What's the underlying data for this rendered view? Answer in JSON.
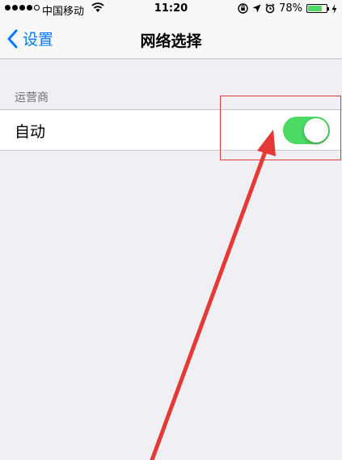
{
  "status_bar": {
    "signal_strength": "4/5",
    "carrier": "中国移动",
    "time": "11:20",
    "battery_percent": "78%",
    "battery_level": 0.78,
    "icons": [
      "signal-icon",
      "wifi-icon",
      "orientation-lock-icon",
      "location-icon",
      "alarm-icon",
      "battery-icon",
      "charging-icon"
    ]
  },
  "nav": {
    "back_label": "设置",
    "title": "网络选择"
  },
  "section": {
    "header": "运营商",
    "row_label": "自动",
    "toggle_on": true
  },
  "colors": {
    "accent": "#007aff",
    "toggle_on": "#4cd964",
    "annotation": "#e53935",
    "background": "#efeff4"
  }
}
